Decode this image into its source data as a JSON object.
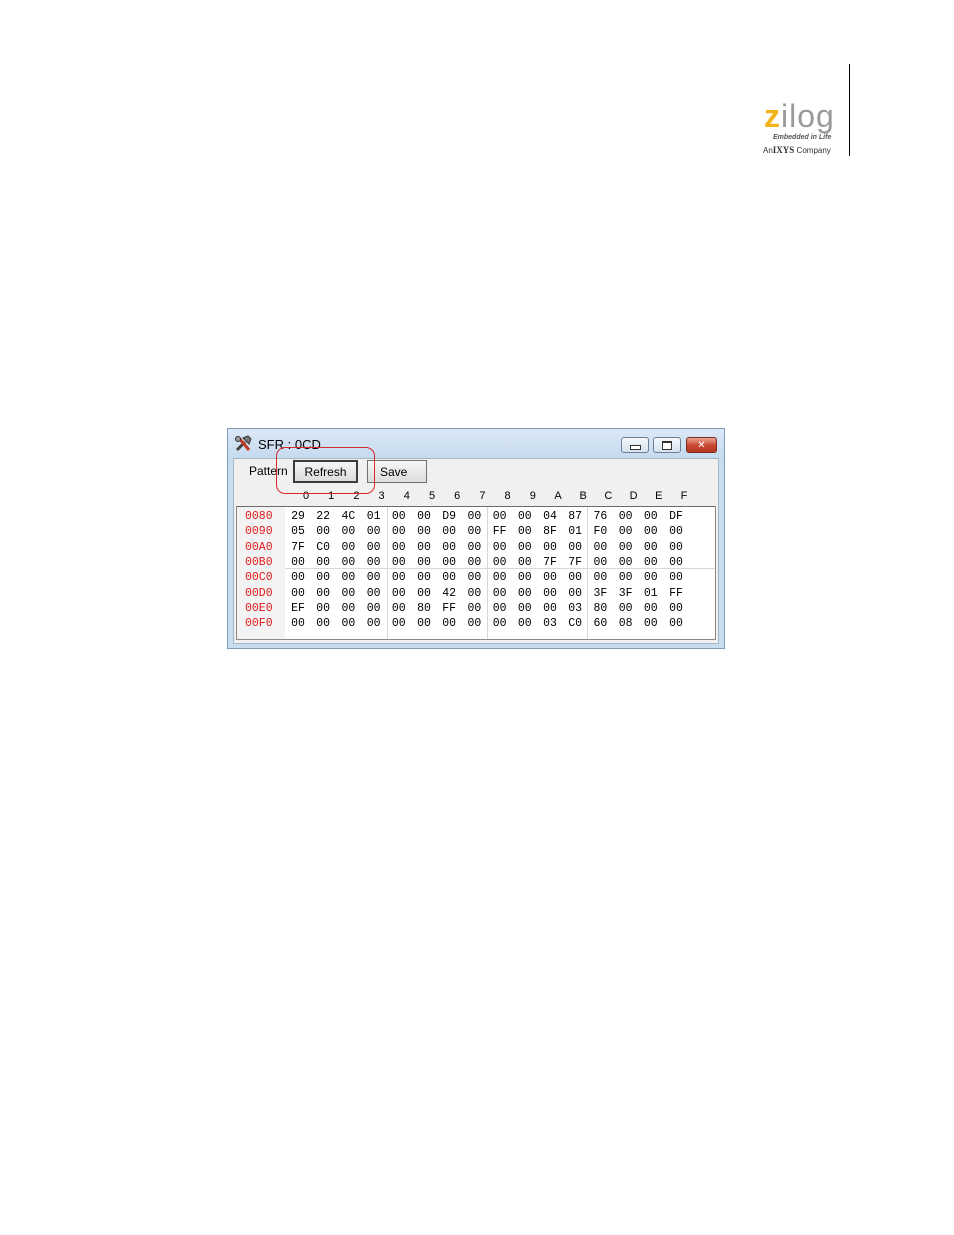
{
  "logo": {
    "word_accent": "z",
    "word_rest": "ilog",
    "tagline": "Embedded in Life",
    "sub_prefix": "An",
    "sub_brand": "IXYS",
    "sub_suffix": "Company",
    "colors": {
      "accent": "#f3b31a",
      "word": "#9a9a9a"
    }
  },
  "window": {
    "title": "SFR : 0CD",
    "icon": "tools-icon",
    "controls": {
      "minimize": "minimize-icon",
      "maximize": "maximize-icon",
      "close": "✕"
    }
  },
  "toolbar": {
    "pattern_label": "Pattern",
    "refresh_label": "Refresh",
    "save_label": "Save"
  },
  "columns": [
    "0",
    "1",
    "2",
    "3",
    "4",
    "5",
    "6",
    "7",
    "8",
    "9",
    "A",
    "B",
    "C",
    "D",
    "E",
    "F"
  ],
  "rows": [
    {
      "addr": "0080",
      "cells": [
        "29",
        "22",
        "4C",
        "01",
        "00",
        "00",
        "D9",
        "00",
        "00",
        "00",
        "04",
        "87",
        "76",
        "00",
        "00",
        "DF"
      ]
    },
    {
      "addr": "0090",
      "cells": [
        "05",
        "00",
        "00",
        "00",
        "00",
        "00",
        "00",
        "00",
        "FF",
        "00",
        "8F",
        "01",
        "F0",
        "00",
        "00",
        "00"
      ]
    },
    {
      "addr": "00A0",
      "cells": [
        "7F",
        "C0",
        "00",
        "00",
        "00",
        "00",
        "00",
        "00",
        "00",
        "00",
        "00",
        "00",
        "00",
        "00",
        "00",
        "00"
      ]
    },
    {
      "addr": "00B0",
      "cells": [
        "00",
        "00",
        "00",
        "00",
        "00",
        "00",
        "00",
        "00",
        "00",
        "00",
        "7F",
        "7F",
        "00",
        "00",
        "00",
        "00"
      ]
    },
    {
      "addr": "00C0",
      "cells": [
        "00",
        "00",
        "00",
        "00",
        "00",
        "00",
        "00",
        "00",
        "00",
        "00",
        "00",
        "00",
        "00",
        "00",
        "00",
        "00"
      ]
    },
    {
      "addr": "00D0",
      "cells": [
        "00",
        "00",
        "00",
        "00",
        "00",
        "00",
        "42",
        "00",
        "00",
        "00",
        "00",
        "00",
        "3F",
        "3F",
        "01",
        "FF"
      ]
    },
    {
      "addr": "00E0",
      "cells": [
        "EF",
        "00",
        "00",
        "00",
        "00",
        "80",
        "FF",
        "00",
        "00",
        "00",
        "00",
        "03",
        "80",
        "00",
        "00",
        "00"
      ]
    },
    {
      "addr": "00F0",
      "cells": [
        "00",
        "00",
        "00",
        "00",
        "00",
        "00",
        "00",
        "00",
        "00",
        "00",
        "03",
        "C0",
        "60",
        "08",
        "00",
        "00"
      ]
    }
  ],
  "colors": {
    "address_text": "#e0181a",
    "highlight_outline": "#d9282c",
    "titlebar": "#c9ddf1"
  }
}
